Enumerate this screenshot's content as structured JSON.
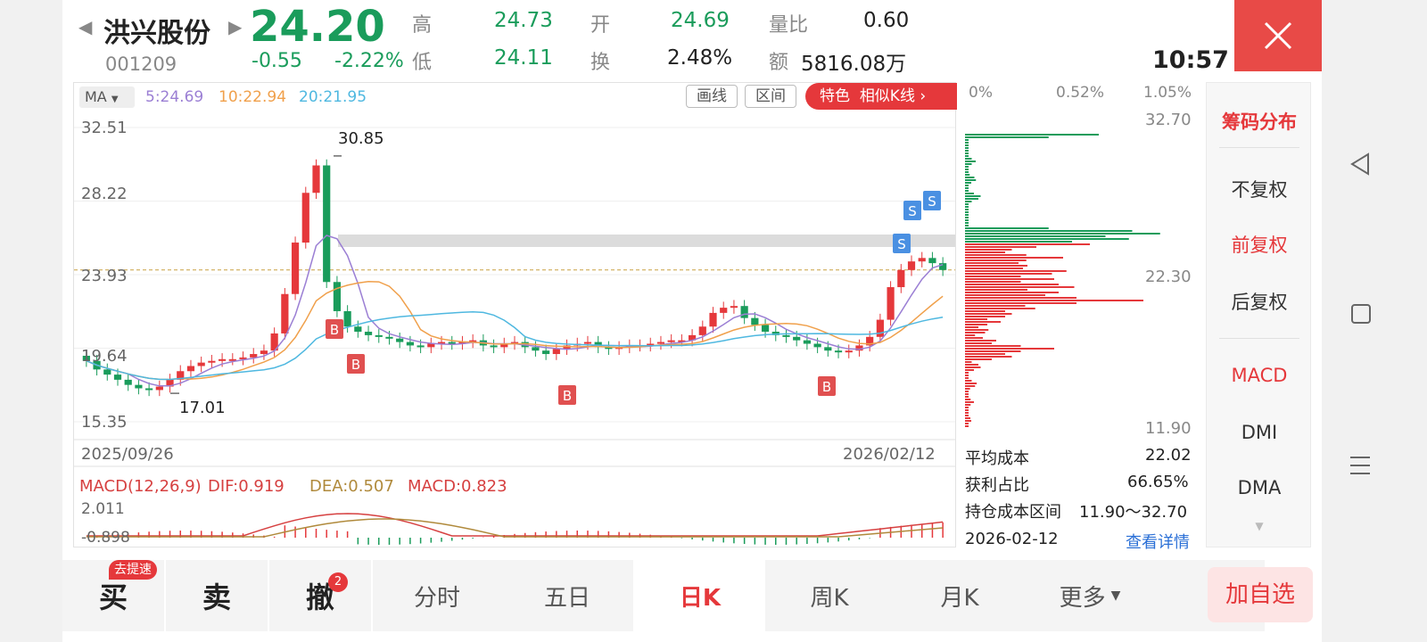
{
  "stock": {
    "name": "洪兴股份",
    "code": "001209",
    "price": "24.20",
    "change": "-0.55",
    "change_pct": "-2.22%",
    "time": "10:57"
  },
  "quote": {
    "high_label": "高",
    "high": "24.73",
    "low_label": "低",
    "low": "24.11",
    "open_label": "开",
    "open": "24.69",
    "turnover_label": "换",
    "turnover": "2.48%",
    "vol_ratio_label": "量比",
    "vol_ratio": "0.60",
    "amount_label": "额",
    "amount": "5816.08万"
  },
  "kline": {
    "ma_selector": "MA",
    "ma5": "5:24.69",
    "ma10": "10:22.94",
    "ma20": "20:21.95",
    "draw_line": "画线",
    "interval": "区间",
    "feature_tag": "特色",
    "similar_k": "相似K线",
    "y_ticks": [
      "32.51",
      "28.22",
      "23.93",
      "19.64",
      "15.35"
    ],
    "high_mark": "30.85",
    "low_mark": "17.01",
    "date_start": "2025/09/26",
    "date_end": "2026/02/12",
    "buy_marker": "B",
    "sell_marker": "S"
  },
  "macd": {
    "title": "MACD(12,26,9)",
    "dif": "DIF:0.919",
    "dea": "DEA:0.507",
    "macd": "MACD:0.823",
    "top": "2.011",
    "bottom": "-0.898"
  },
  "chips": {
    "pct_0": "0%",
    "pct_mid": "0.52%",
    "pct_max": "1.05%",
    "price_top": "32.70",
    "price_mid": "22.30",
    "price_bottom": "11.90",
    "avg_cost_label": "平均成本",
    "avg_cost": "22.02",
    "profit_label": "获利占比",
    "profit": "66.65%",
    "range_label": "持仓成本区间",
    "range": "11.90～32.70",
    "date": "2026-02-12",
    "detail_link": "查看详情"
  },
  "side": {
    "title": "筹码分布",
    "items": [
      "不复权",
      "前复权",
      "后复权",
      "MACD",
      "DMI",
      "DMA"
    ]
  },
  "bottom": {
    "buy": "买",
    "buy_badge": "去提速",
    "sell": "卖",
    "cancel": "撤",
    "cancel_badge": "2",
    "tabs": [
      "分时",
      "五日",
      "日K",
      "周K",
      "月K",
      "更多"
    ],
    "add_watch": "加自选"
  },
  "colors": {
    "up": "#e5383b",
    "down": "#1a9c5b",
    "ma5": "#9b7fd4",
    "ma10": "#f0a04b",
    "ma20": "#4fb8e0",
    "accent": "#e84a47"
  }
}
